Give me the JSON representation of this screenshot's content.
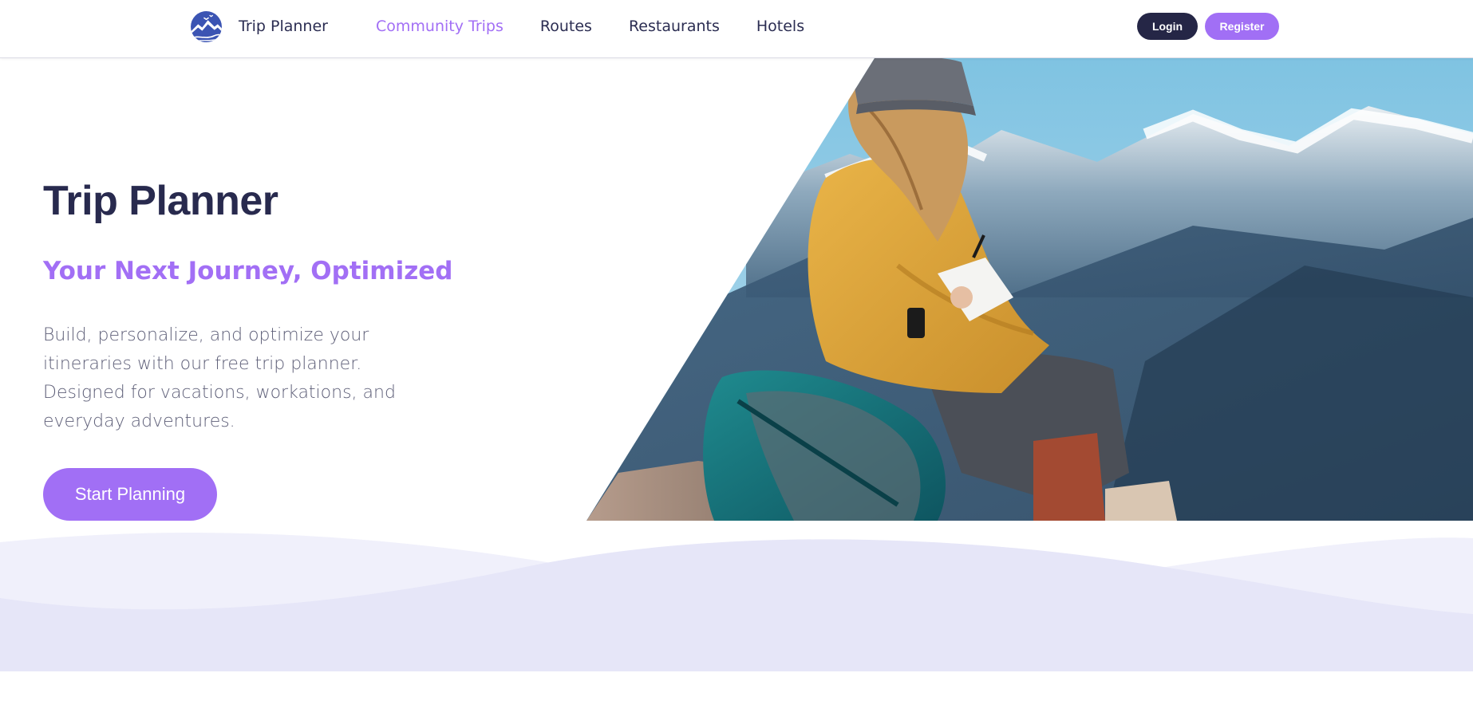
{
  "header": {
    "brand_name": "Trip Planner",
    "nav": [
      {
        "label": "Community Trips",
        "active": true
      },
      {
        "label": "Routes",
        "active": false
      },
      {
        "label": "Restaurants",
        "active": false
      },
      {
        "label": "Hotels",
        "active": false
      }
    ],
    "login_label": "Login",
    "register_label": "Register"
  },
  "hero": {
    "title": "Trip Planner",
    "subtitle": "Your Next Journey, Optimized",
    "description": "Build, personalize, and optimize your itineraries with our free trip planner. Designed for vacations, workations, and everyday adventures.",
    "cta_label": "Start Planning",
    "image_icon": "hiker-journaling-mountains-photo"
  },
  "colors": {
    "accent": "#a26ff5",
    "navy": "#252646",
    "wave_light": "#f0f0fb",
    "wave_mid": "#e6e6f8"
  }
}
